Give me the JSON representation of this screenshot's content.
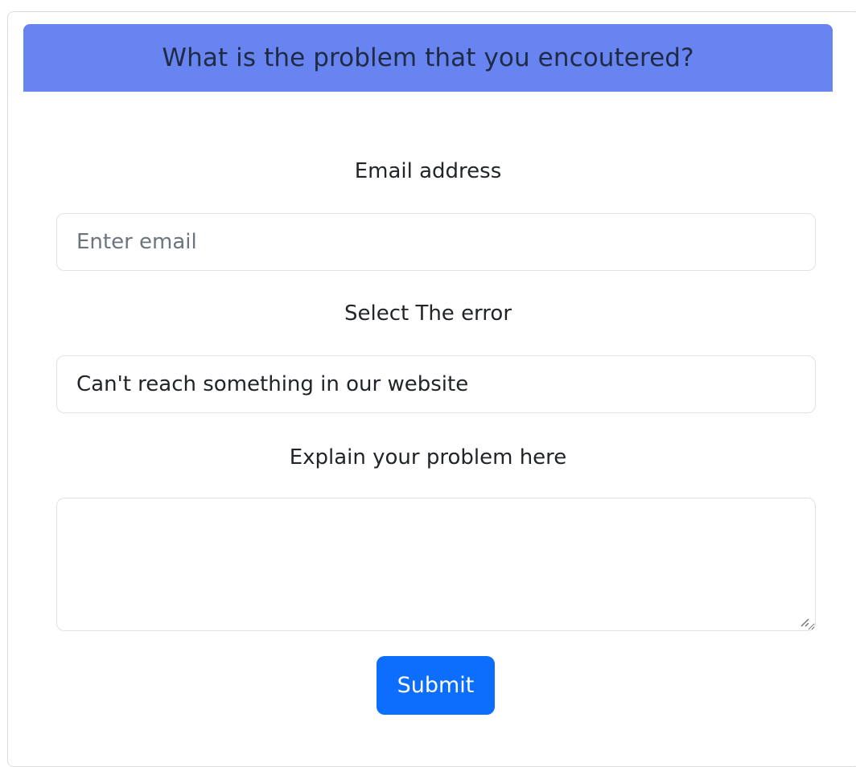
{
  "form": {
    "header_title": "What is the problem that you encoutered?",
    "email": {
      "label": "Email address",
      "placeholder": "Enter email",
      "value": ""
    },
    "error_select": {
      "label": "Select The error",
      "selected": "Can't reach something in our website"
    },
    "problem": {
      "label": "Explain your problem here",
      "value": ""
    },
    "submit_label": "Submit"
  },
  "colors": {
    "header_bg": "#6884f0",
    "submit_bg": "#0d6efd",
    "border": "#dee2e6"
  },
  "icons": {
    "textarea_resize": "resize-grip-icon"
  }
}
